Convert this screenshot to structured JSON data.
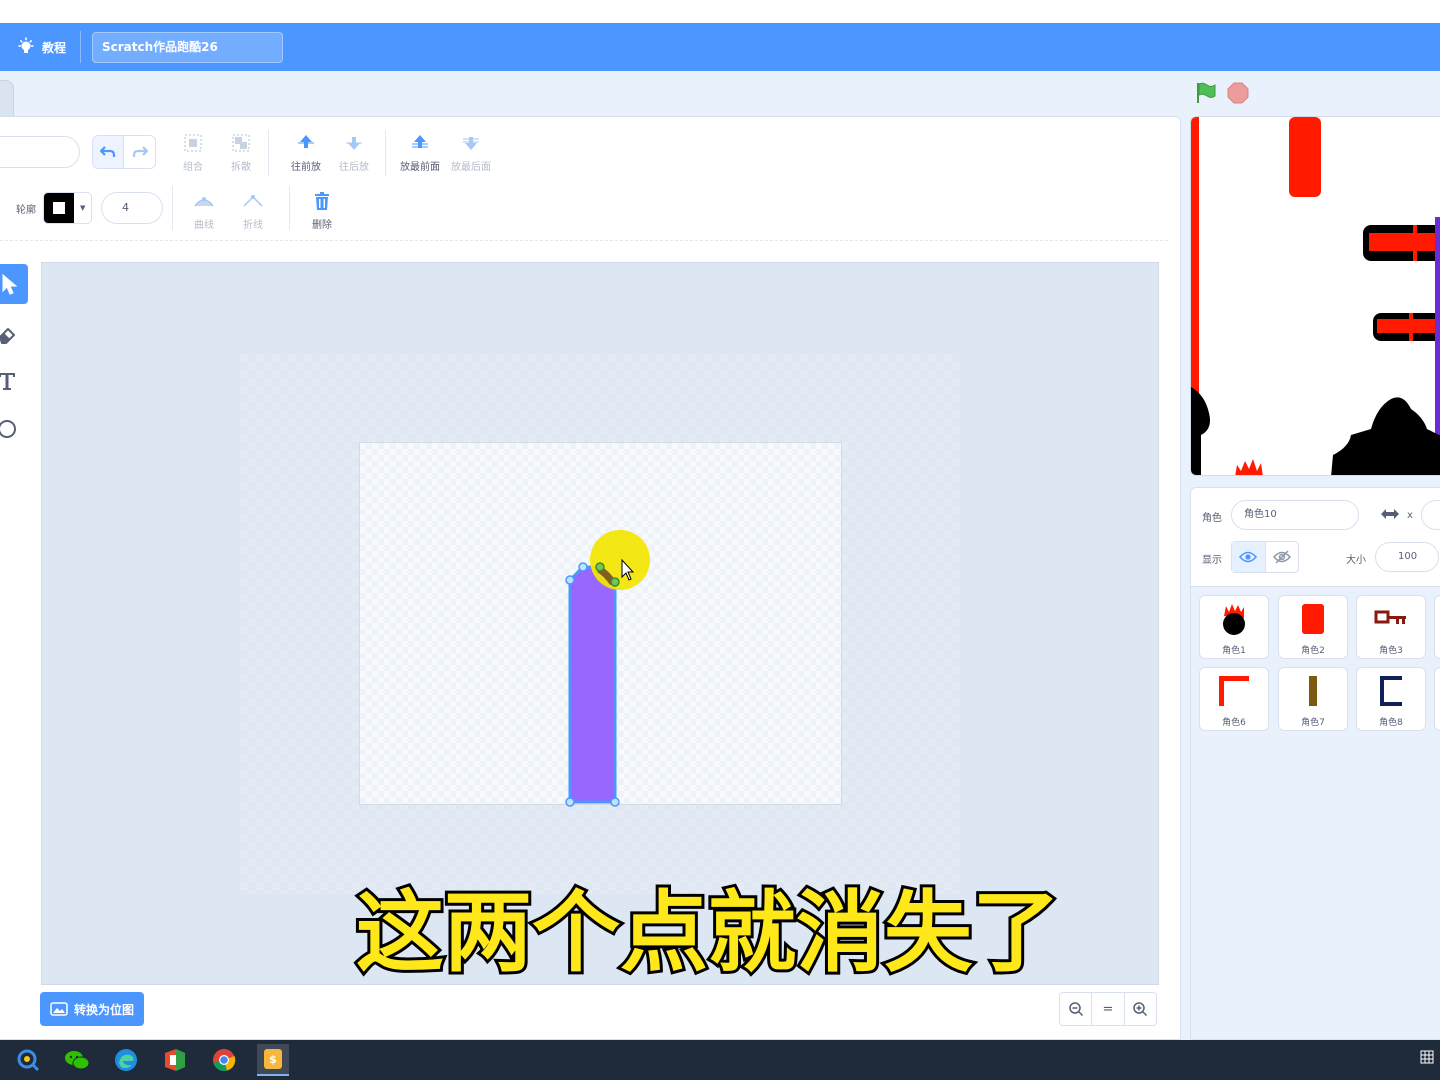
{
  "menubar": {
    "tutorial_label": "教程",
    "project_title": "Scratch作品跑酷26",
    "bg_color": "#4c97ff"
  },
  "paint_toolbar": {
    "group_label": "组合",
    "ungroup_label": "拆散",
    "forward_label": "往前放",
    "backward_label": "往后放",
    "front_label": "放最前面",
    "back_label": "放最后面",
    "outline_label": "轮廓",
    "outline_width": "4",
    "curve_label": "曲线",
    "polyline_label": "折线",
    "delete_label": "删除"
  },
  "left_tools": [
    "select-icon",
    "eraser-icon",
    "text-icon",
    "circle-icon"
  ],
  "canvas": {
    "shape_fill": "#9966ff",
    "shape_stroke": "#4c97ff"
  },
  "bottom": {
    "convert_label": "转换为位图",
    "zoom_out": "−",
    "zoom_reset": "=",
    "zoom_in": "+"
  },
  "subtitle": "这两个点就消失了",
  "sprite_info": {
    "sprite_label": "角色",
    "sprite_name": "角色10",
    "x_label": "x",
    "show_label": "显示",
    "size_label": "大小",
    "size_value": "100"
  },
  "sprites": [
    {
      "name": "角色1",
      "icon": "black-ball-flame"
    },
    {
      "name": "角色2",
      "icon": "red-block"
    },
    {
      "name": "角色3",
      "icon": "red-key"
    },
    {
      "name": "角色6",
      "icon": "red-corner"
    },
    {
      "name": "角色7",
      "icon": "brown-bar"
    },
    {
      "name": "角色8",
      "icon": "navy-bracket"
    }
  ]
}
